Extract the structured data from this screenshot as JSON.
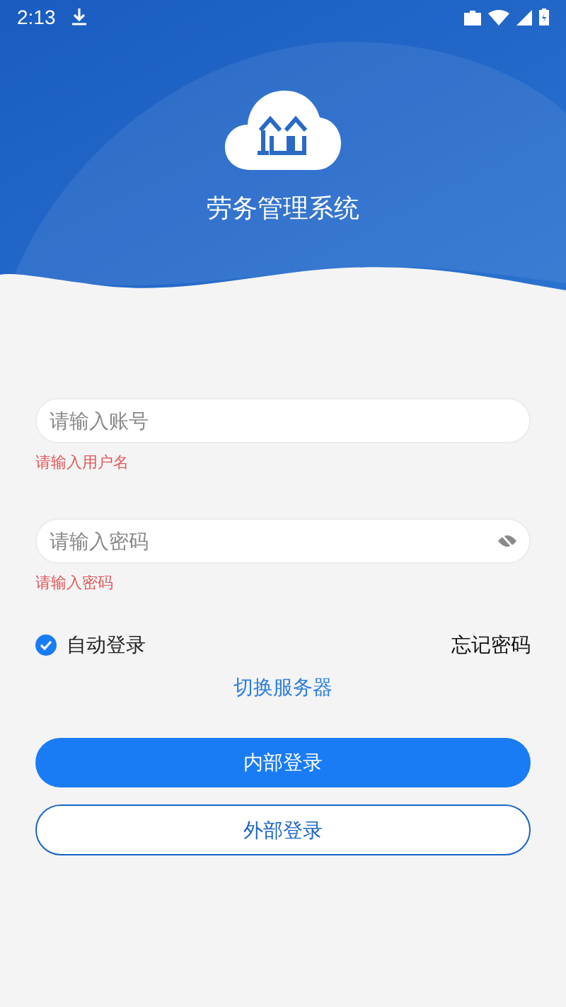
{
  "status_bar": {
    "time": "2:13"
  },
  "app_title": "劳务管理系统",
  "username": {
    "placeholder": "请输入账号",
    "error": "请输入用户名"
  },
  "password": {
    "placeholder": "请输入密码",
    "error": "请输入密码"
  },
  "auto_login": {
    "label": "自动登录",
    "checked": true
  },
  "forgot_password": "忘记密码",
  "switch_server": "切换服务器",
  "buttons": [
    {
      "label": "内部登录",
      "kind": "primary"
    },
    {
      "label": "外部登录",
      "kind": "outline"
    }
  ]
}
